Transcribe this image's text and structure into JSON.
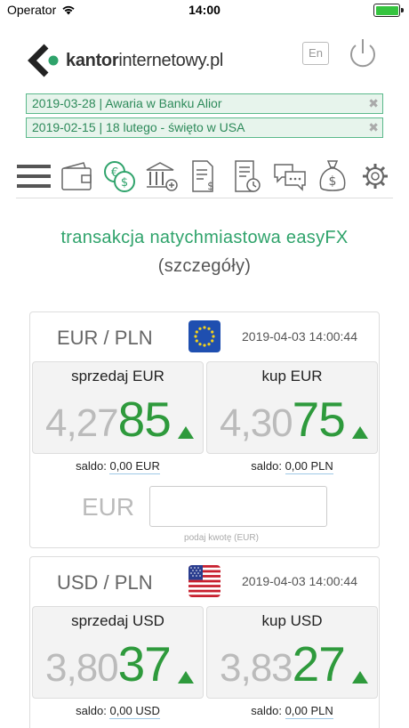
{
  "status_bar": {
    "carrier": "Operator",
    "time": "14:00"
  },
  "header": {
    "logo_bold": "kantor",
    "logo_rest": "internetowy.pl",
    "lang_button": "En"
  },
  "news": [
    {
      "text": "2019-03-28 | Awaria w Banku Alior",
      "close": "✖"
    },
    {
      "text": "2019-02-15 | 18 lutego - święto w USA",
      "close": "✖"
    }
  ],
  "toolbar_icons": [
    "menu-icon",
    "wallet-icon",
    "currency-exchange-icon",
    "bank-icon",
    "invoice-icon",
    "history-icon",
    "chat-icon",
    "money-bag-icon",
    "settings-icon"
  ],
  "page": {
    "title": "transakcja natychmiastowa easyFX",
    "subtitle": "(szczegóły)"
  },
  "cards": [
    {
      "pair": "EUR / PLN",
      "flag": "eu-flag-icon",
      "date": "2019-04-03 14:00:44",
      "sell": {
        "label": "sprzedaj EUR",
        "rate_prefix": "4,27",
        "rate_suffix": "85",
        "trend": "up"
      },
      "buy": {
        "label": "kup EUR",
        "rate_prefix": "4,30",
        "rate_suffix": "75",
        "trend": "up"
      },
      "sell_saldo_label": "saldo:",
      "sell_saldo": "0,00 EUR",
      "buy_saldo_label": "saldo:",
      "buy_saldo": "0,00 PLN",
      "amount_currency": "EUR",
      "amount_value": "",
      "amount_hint": "podaj kwotę (EUR)"
    },
    {
      "pair": "USD / PLN",
      "flag": "us-flag-icon",
      "date": "2019-04-03 14:00:44",
      "sell": {
        "label": "sprzedaj USD",
        "rate_prefix": "3,80",
        "rate_suffix": "37",
        "trend": "up"
      },
      "buy": {
        "label": "kup USD",
        "rate_prefix": "3,83",
        "rate_suffix": "27",
        "trend": "up"
      },
      "sell_saldo_label": "saldo:",
      "sell_saldo": "0,00 USD",
      "buy_saldo_label": "saldo:",
      "buy_saldo": "0,00 PLN"
    }
  ],
  "colors": {
    "accent_green": "#2fa36b",
    "rate_green": "#2e9a3c",
    "news_border": "#5bb98b",
    "news_bg": "#e7f4ec"
  }
}
